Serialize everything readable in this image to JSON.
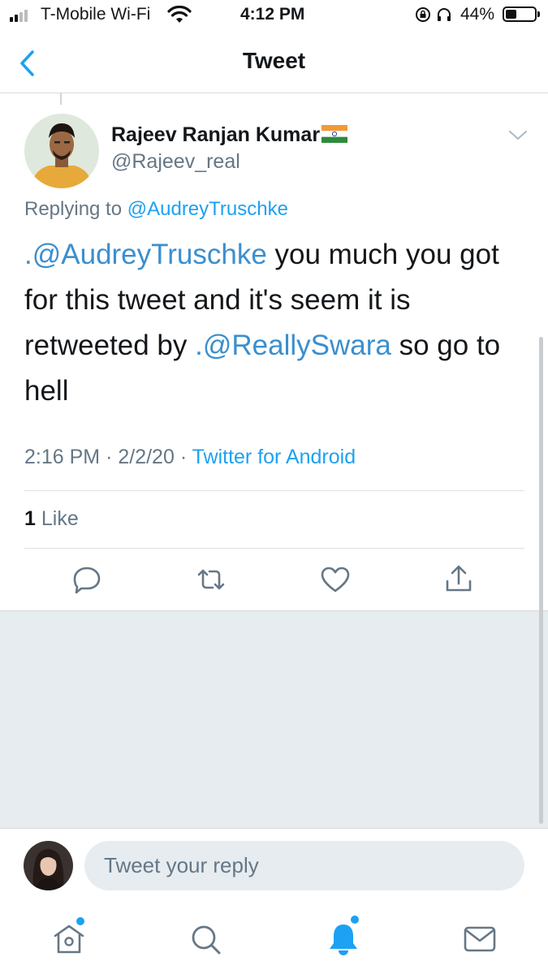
{
  "status_bar": {
    "carrier": "T-Mobile Wi-Fi",
    "time": "4:12 PM",
    "battery_percent": "44%",
    "battery_level": 0.44,
    "icons": [
      "signal-icon",
      "wifi-icon",
      "orientation-lock-icon",
      "headphones-icon",
      "battery-icon"
    ]
  },
  "nav": {
    "title": "Tweet",
    "back_icon": "chevron-left-icon"
  },
  "tweet": {
    "author_name": "Rajeev Ranjan Kumar",
    "author_flag_icon": "india-flag-icon",
    "handle": "@Rajeev_real",
    "replying_prefix": "Replying to",
    "replying_to": "@AudreyTruschke",
    "text_parts": {
      "mention1": ".@AudreyTruschke",
      "part1": "you much you got for this tweet and it's seem it is retweeted by",
      "mention2": ".@ReallySwara",
      "part2": "so go to hell"
    },
    "time": "2:16 PM",
    "date": "2/2/20",
    "separator": "·",
    "source": "Twitter for Android",
    "like_count": "1",
    "like_label": "Like",
    "actions": [
      "reply-icon",
      "retweet-icon",
      "like-icon",
      "share-icon"
    ]
  },
  "reply": {
    "placeholder": "Tweet your reply"
  },
  "tab_bar": {
    "items": [
      "home-icon",
      "search-icon",
      "notifications-icon",
      "messages-icon"
    ],
    "active": "notifications-icon"
  },
  "colors": {
    "accent": "#1da1f2",
    "secondary_text": "#657786",
    "background_grey": "#e6ecf0"
  }
}
